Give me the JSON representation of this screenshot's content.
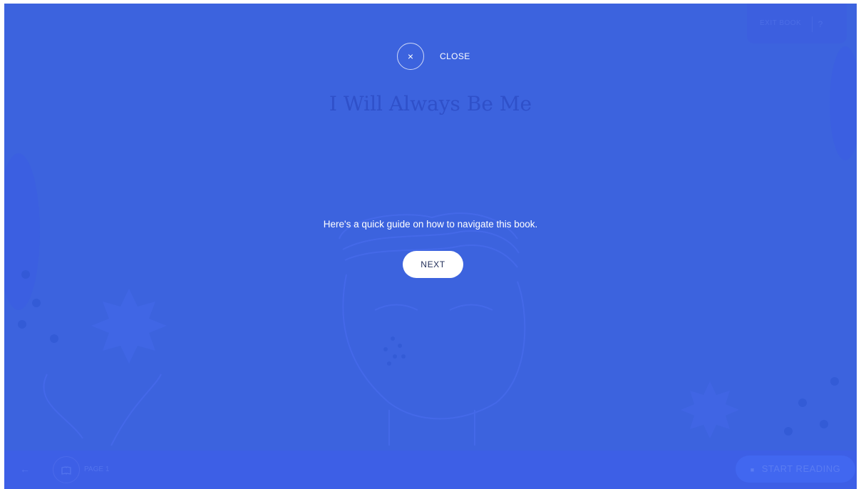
{
  "book": {
    "title": "I Will Always Be Me"
  },
  "header": {
    "exit_book_label": "EXIT BOOK",
    "help_label": "?"
  },
  "footer": {
    "back_icon": "←",
    "toc_icon": "book-icon",
    "page_label": "PAGE 1",
    "start_reading_label": "START READING",
    "start_reading_icon": "■"
  },
  "overlay": {
    "close_icon": "×",
    "close_label": "CLOSE",
    "guide_text": "Here's a quick guide on how to navigate this book.",
    "next_label": "NEXT"
  },
  "colors": {
    "overlay_background": "#3c63de",
    "button_background": "#ffffff",
    "button_text": "#1f2c57"
  }
}
